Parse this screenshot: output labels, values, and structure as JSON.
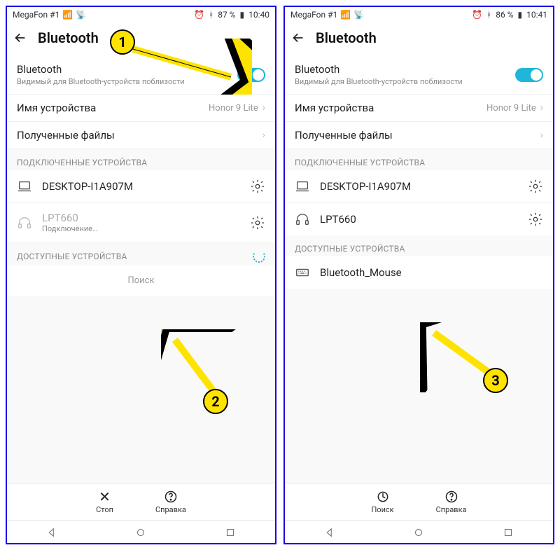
{
  "status": {
    "carrier": "MegaFon #1",
    "battery_left": "87 %",
    "time_left": "10:40",
    "battery_right": "86 %",
    "time_right": "10:41"
  },
  "screen": {
    "title": "Bluetooth",
    "bluetooth_label": "Bluetooth",
    "bluetooth_sub": "Видимый для Bluetooth-устройств поблизости",
    "device_name_label": "Имя устройства",
    "device_name_value": "Honor 9 Lite",
    "received_files_label": "Полученные файлы",
    "section_paired": "ПОДКЛЮЧЕННЫЕ УСТРОЙСТВА",
    "section_available": "ДОСТУПНЫЕ УСТРОЙСТВА"
  },
  "paired_left": [
    {
      "name": "DESKTOP-I1A907M",
      "type": "laptop"
    },
    {
      "name": "LPT660",
      "type": "headphones",
      "sub": "Подключение…"
    }
  ],
  "paired_right": [
    {
      "name": "DESKTOP-I1A907M",
      "type": "laptop"
    },
    {
      "name": "LPT660",
      "type": "headphones"
    }
  ],
  "available_left_scanning_text": "Поиск",
  "available_right": [
    {
      "name": "Bluetooth_Mouse",
      "type": "keyboard"
    }
  ],
  "actions_left": {
    "primary_label": "Стоп",
    "secondary_label": "Справка"
  },
  "actions_right": {
    "primary_label": "Поиск",
    "secondary_label": "Справка"
  },
  "callouts": {
    "c1": "1",
    "c2": "2",
    "c3": "3"
  }
}
